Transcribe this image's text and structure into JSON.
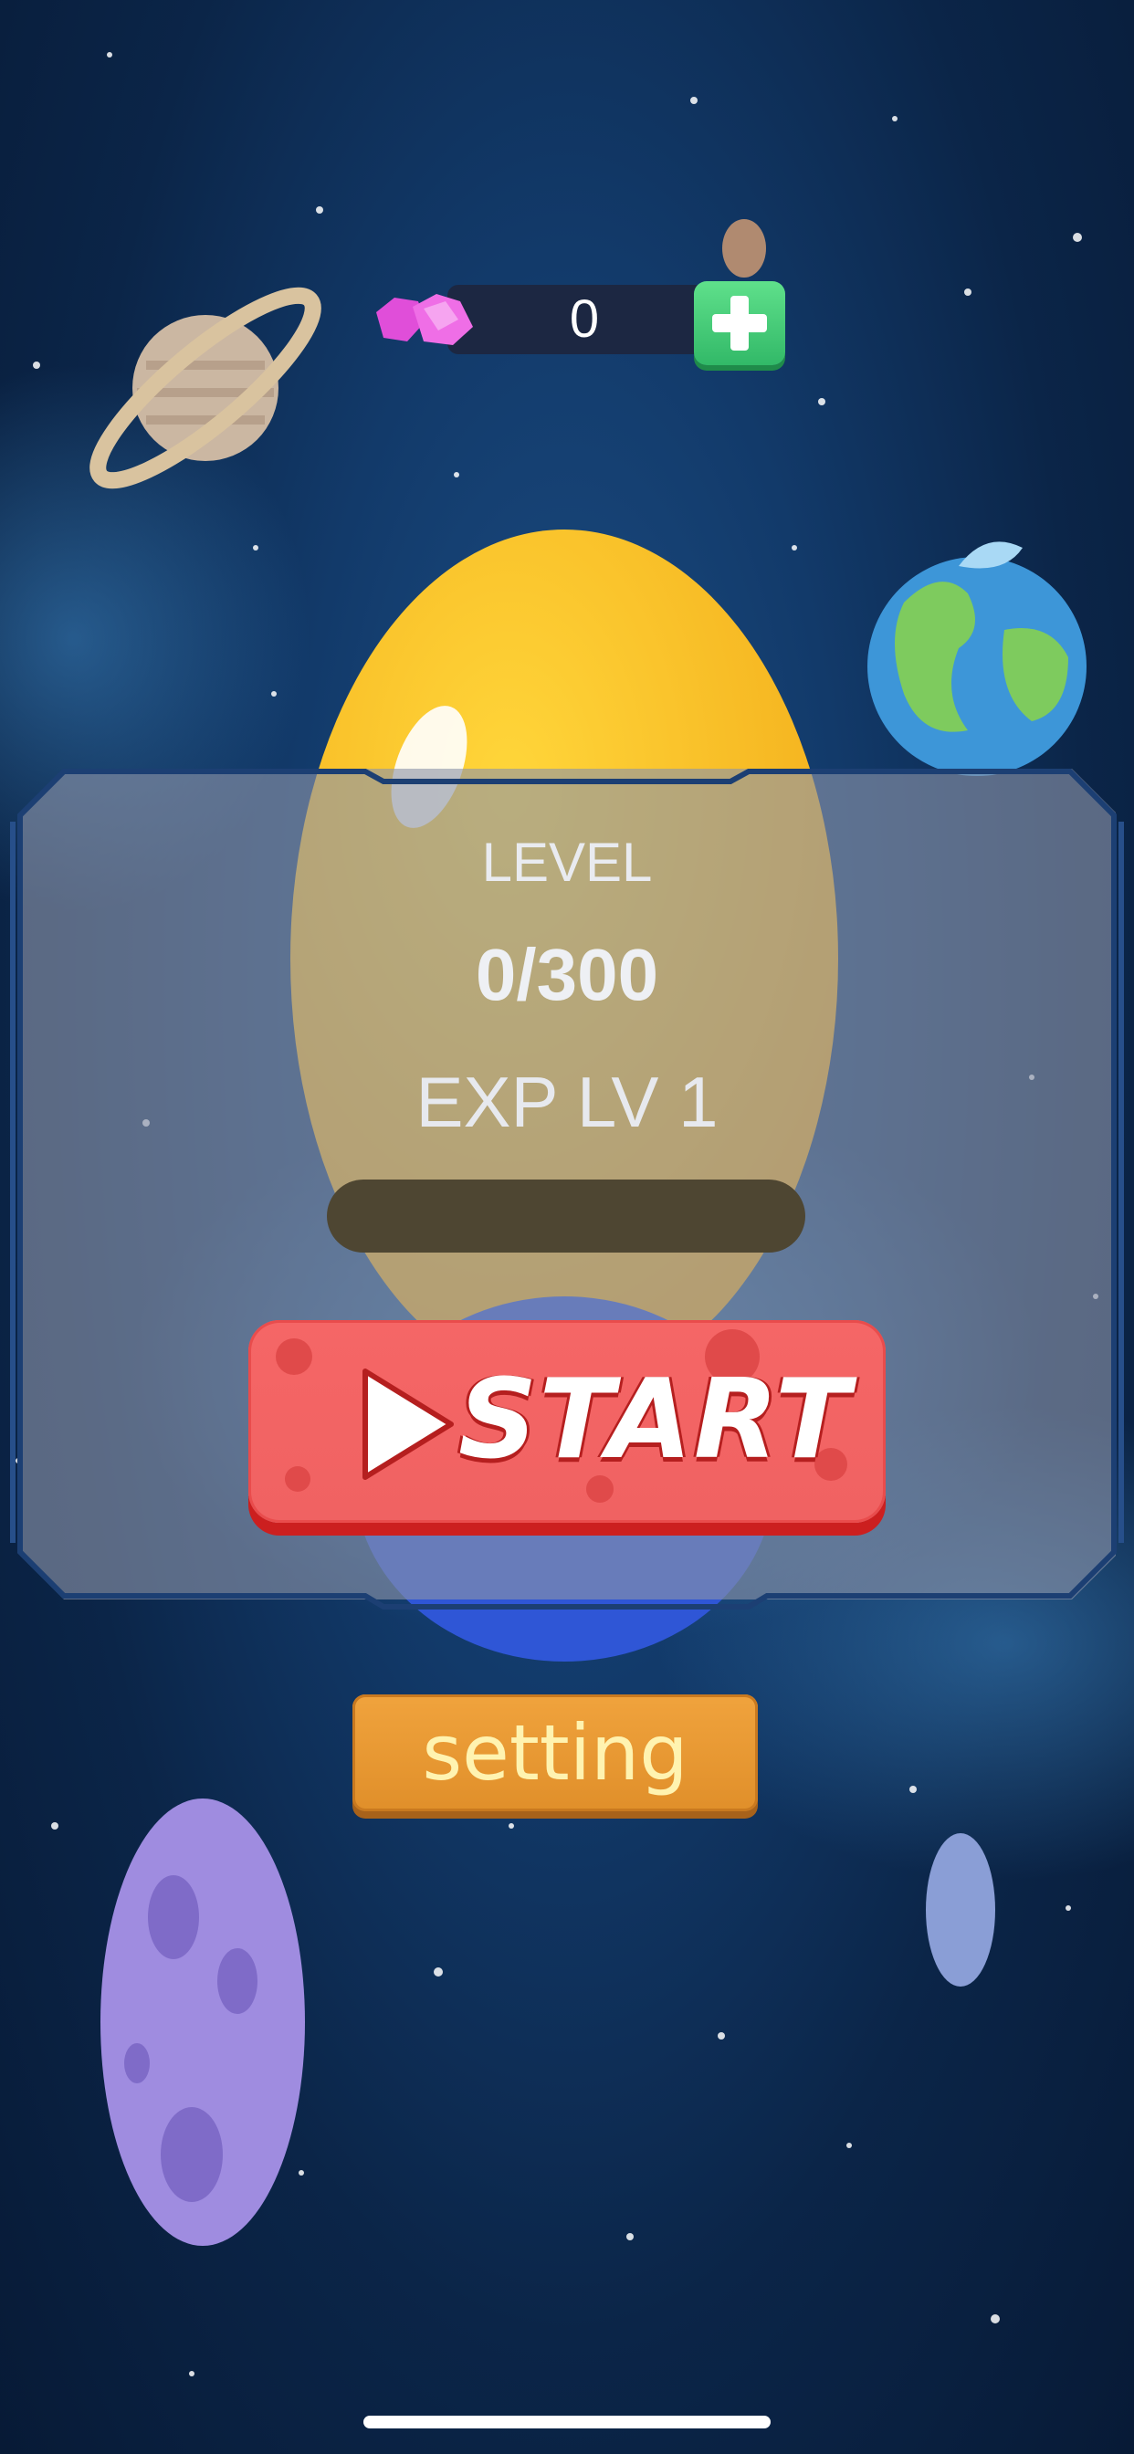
{
  "currency": {
    "gems": "0",
    "icon": "pink-gem-icon",
    "add_icon": "plus-icon"
  },
  "panel": {
    "level_label": "LEVEL",
    "level_value": "0/300",
    "exp_label": "EXP LV 1",
    "exp_progress": 0
  },
  "buttons": {
    "start": "START",
    "setting": "setting"
  },
  "colors": {
    "start": "#f56666",
    "setting": "#e08f2a",
    "plus": "#32b968",
    "gem": "#e04ed9"
  }
}
